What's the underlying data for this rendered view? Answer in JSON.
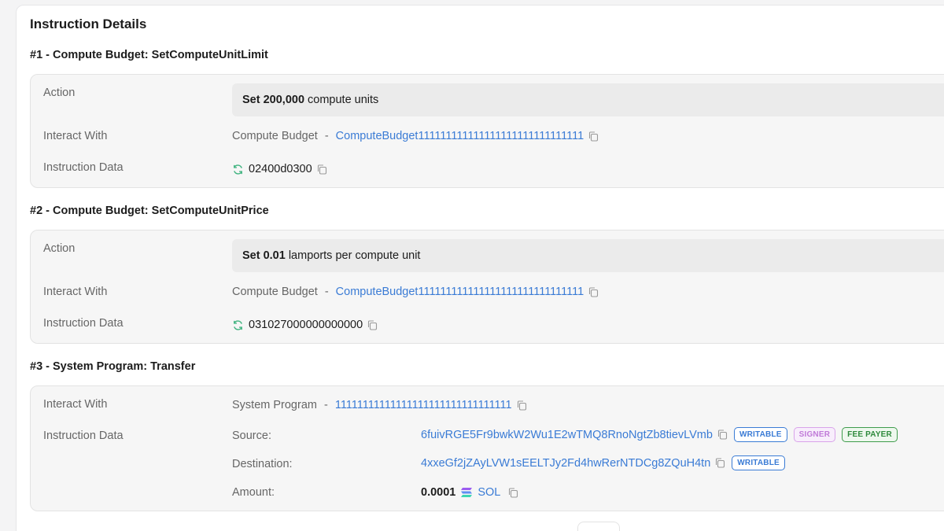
{
  "page_title": "Instruction Details",
  "instructions": [
    {
      "title": "#1 - Compute Budget: SetComputeUnitLimit",
      "action_label": "Action",
      "action_bold": "Set 200,000",
      "action_rest": "compute units",
      "interact_label": "Interact With",
      "program_name": "Compute Budget",
      "dash": "-",
      "program_id": "ComputeBudget111111111111111111111111111111",
      "data_label": "Instruction Data",
      "data_value": "02400d0300"
    },
    {
      "title": "#2 - Compute Budget: SetComputeUnitPrice",
      "action_label": "Action",
      "action_bold": "Set 0.01",
      "action_rest": "lamports per compute unit",
      "interact_label": "Interact With",
      "program_name": "Compute Budget",
      "dash": "-",
      "program_id": "ComputeBudget111111111111111111111111111111",
      "data_label": "Instruction Data",
      "data_value": "031027000000000000"
    },
    {
      "title": "#3 - System Program: Transfer",
      "interact_label": "Interact With",
      "program_name": "System Program",
      "dash": "-",
      "program_id": "11111111111111111111111111111111",
      "data_label": "Instruction Data",
      "source_label": "Source:",
      "source_value": "6fuivRGE5Fr9bwkW2Wu1E2wTMQ8RnoNgtZb8tievLVmb",
      "source_badges": [
        "WRITABLE",
        "SIGNER",
        "FEE PAYER"
      ],
      "destination_label": "Destination:",
      "destination_value": "4xxeGf2jZAyLVW1sEELTJy2Fd4hwRerNTDCg8ZQuH4tn",
      "destination_badges": [
        "WRITABLE"
      ],
      "amount_label": "Amount:",
      "amount_value": "0.0001",
      "amount_token": "SOL"
    }
  ],
  "colors": {
    "link": "#3a7bd5",
    "refresh_icon": "#3fb37f",
    "writable": "#3a7bd5",
    "signer": "#c07ad8",
    "fee_payer": "#2e8a3c"
  },
  "icons": {
    "copy": "copy-icon",
    "refresh": "refresh-icon",
    "sol": "solana-logo-icon"
  }
}
